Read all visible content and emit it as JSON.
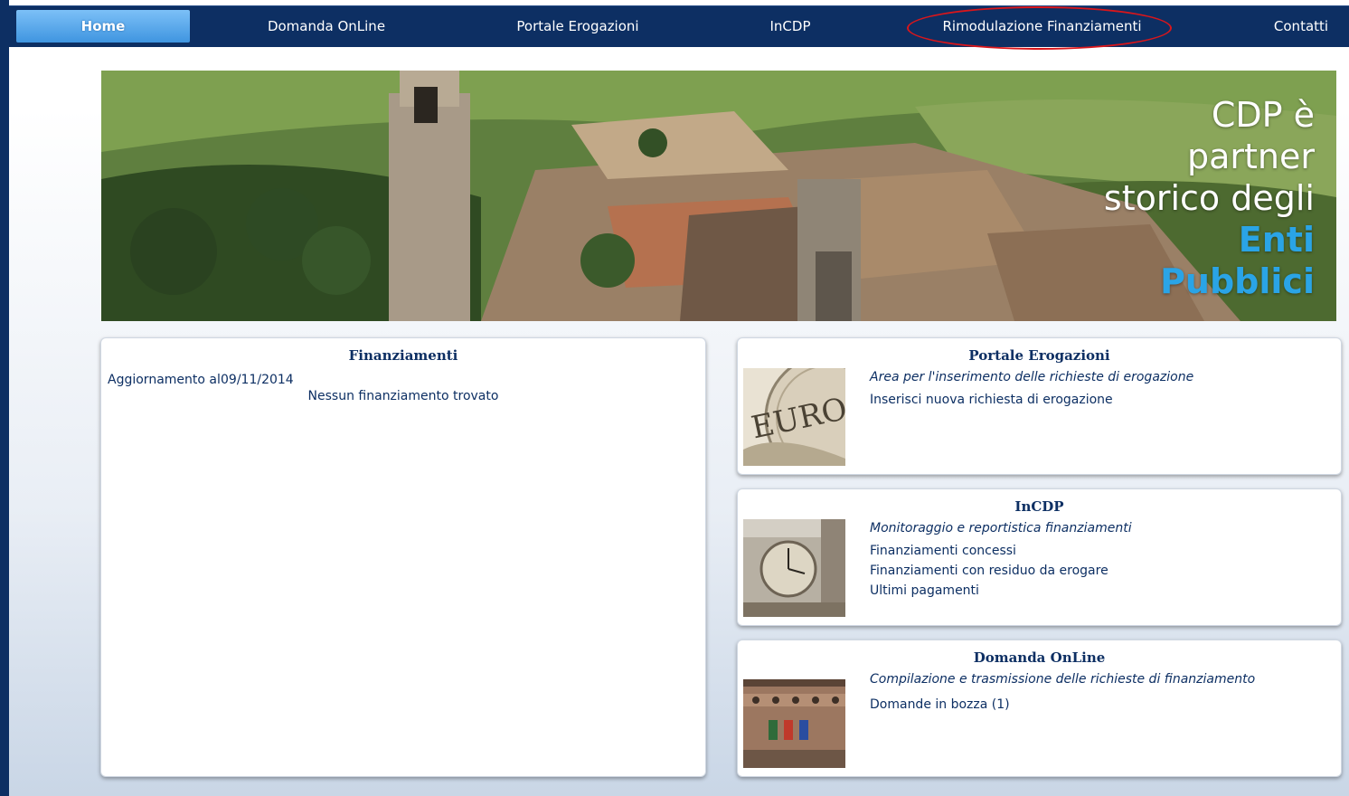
{
  "nav": {
    "items": [
      {
        "label": "Home",
        "active": true
      },
      {
        "label": "Domanda OnLine"
      },
      {
        "label": "Portale Erogazioni"
      },
      {
        "label": "InCDP"
      },
      {
        "label": "Rimodulazione Finanziamenti",
        "highlighted": true
      },
      {
        "label": "Contatti"
      }
    ]
  },
  "banner": {
    "line1": "CDP è",
    "line2": "partner",
    "line3": "storico degli",
    "line4": "Enti",
    "line5": "Pubblici"
  },
  "finanziamenti": {
    "title": "Finanziamenti",
    "update_label": "Aggiornamento al",
    "update_date": "09/11/2014",
    "empty_message": "Nessun finanziamento trovato"
  },
  "erogazioni": {
    "title": "Portale Erogazioni",
    "subtitle": "Area per l'inserimento delle richieste di erogazione",
    "links": [
      "Inserisci nuova richiesta di erogazione"
    ],
    "image_text": "EURO"
  },
  "incdp": {
    "title": "InCDP",
    "subtitle": "Monitoraggio e reportistica finanziamenti",
    "links": [
      "Finanziamenti concessi",
      "Finanziamenti con residuo da erogare",
      "Ultimi pagamenti"
    ]
  },
  "domanda": {
    "title": "Domanda OnLine",
    "subtitle": "Compilazione e trasmissione delle richieste di finanziamento",
    "links": [
      "Domande in bozza (1)"
    ]
  },
  "colors": {
    "nav_bg": "#0d2f63",
    "active_tab": "#5aaaf0",
    "annotation": "#d9161b",
    "accent": "#2aa4e6",
    "text": "#0d2f63"
  }
}
